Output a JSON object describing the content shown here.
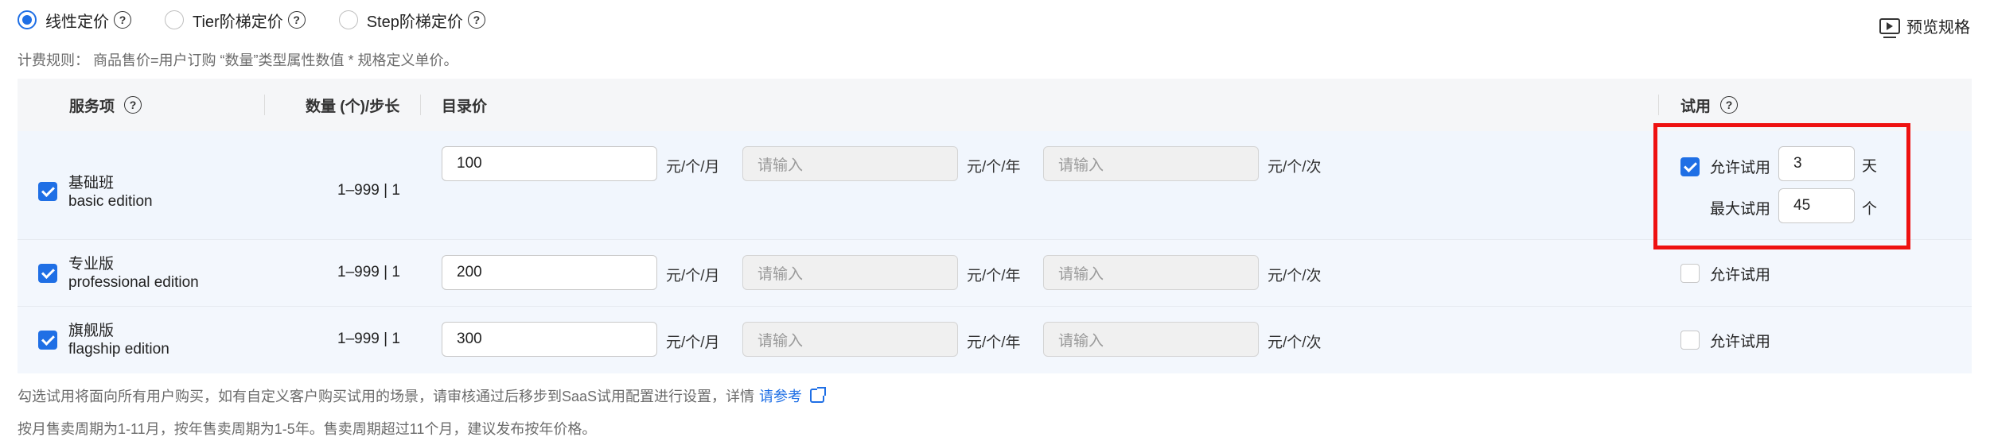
{
  "pricing_modes": [
    {
      "label": "线性定价",
      "checked": true
    },
    {
      "label": "Tier阶梯定价",
      "checked": false
    },
    {
      "label": "Step阶梯定价",
      "checked": false
    }
  ],
  "help_glyph": "?",
  "preview_label": "预览规格",
  "billing_rule": "计费规则： 商品售价=用户订购 “数量”类型属性数值 * 规格定义单价。",
  "table": {
    "headers": {
      "service": "服务项",
      "quantity": "数量 (个)/步长",
      "list_price": "目录价",
      "trial": "试用"
    },
    "rows": [
      {
        "name": "基础班",
        "edition": "basic edition",
        "checked": true,
        "quantity": "1–999 | 1",
        "monthly_price": "100",
        "monthly_unit": "元/个/月",
        "yearly_placeholder": "请输入",
        "yearly_unit": "元/个/年",
        "per_use_placeholder": "请输入",
        "per_use_unit": "元/个/次",
        "allow_trial": true,
        "allow_trial_label": "允许试用",
        "trial_days": "3",
        "trial_days_unit": "天",
        "max_trial_label": "最大试用",
        "max_trial": "45",
        "max_trial_unit": "个"
      },
      {
        "name": "专业版",
        "edition": "professional edition",
        "checked": true,
        "quantity": "1–999 | 1",
        "monthly_price": "200",
        "monthly_unit": "元/个/月",
        "yearly_placeholder": "请输入",
        "yearly_unit": "元/个/年",
        "per_use_placeholder": "请输入",
        "per_use_unit": "元/个/次",
        "allow_trial": false,
        "allow_trial_label": "允许试用"
      },
      {
        "name": "旗舰版",
        "edition": "flagship edition",
        "checked": true,
        "quantity": "1–999 | 1",
        "monthly_price": "300",
        "monthly_unit": "元/个/月",
        "yearly_placeholder": "请输入",
        "yearly_unit": "元/个/年",
        "per_use_placeholder": "请输入",
        "per_use_unit": "元/个/次",
        "allow_trial": false,
        "allow_trial_label": "允许试用"
      }
    ]
  },
  "note_trial": "勾选试用将面向所有用户购买，如有自定义客户购买试用的场景，请审核通过后移步到SaaS试用配置进行设置，详情",
  "note_trial_link": "请参考",
  "note_period": "按月售卖周期为1-11月，按年售卖周期为1-5年。售卖周期超过11个月，建议发布按年价格。",
  "colors": {
    "accent": "#1f6fe5",
    "highlight_border": "#ee1111"
  }
}
